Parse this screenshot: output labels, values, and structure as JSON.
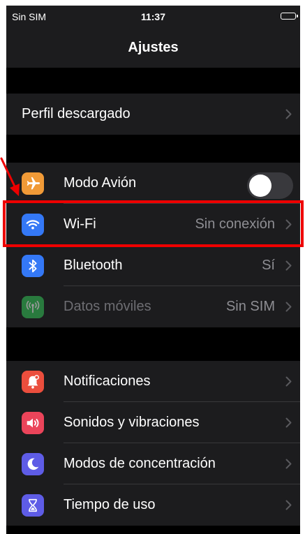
{
  "status_bar": {
    "carrier": "Sin SIM",
    "time": "11:37"
  },
  "nav": {
    "title": "Ajustes"
  },
  "profile_group": [
    {
      "label": "Perfil descargado"
    }
  ],
  "connectivity_group": [
    {
      "label": "Modo Avión",
      "icon": "airplane-icon",
      "icon_color": "#f09a37",
      "toggle_on": false
    },
    {
      "label": "Wi-Fi",
      "value": "Sin conexión",
      "icon": "wifi-icon",
      "icon_color": "#3478f6"
    },
    {
      "label": "Bluetooth",
      "value": "Sí",
      "icon": "bluetooth-icon",
      "icon_color": "#3478f6"
    },
    {
      "label": "Datos móviles",
      "value": "Sin SIM",
      "icon": "antenna-icon",
      "icon_color": "#34c759",
      "disabled": true
    }
  ],
  "notifications_group": [
    {
      "label": "Notificaciones",
      "icon": "bell-icon",
      "icon_color": "#eb4e3d"
    },
    {
      "label": "Sonidos y vibraciones",
      "icon": "speaker-icon",
      "icon_color": "#eb445a"
    },
    {
      "label": "Modos de concentración",
      "icon": "moon-icon",
      "icon_color": "#5e5ce6"
    },
    {
      "label": "Tiempo de uso",
      "icon": "hourglass-icon",
      "icon_color": "#5e5ce6"
    }
  ],
  "annotation": {
    "highlight_color": "#ee0000"
  }
}
